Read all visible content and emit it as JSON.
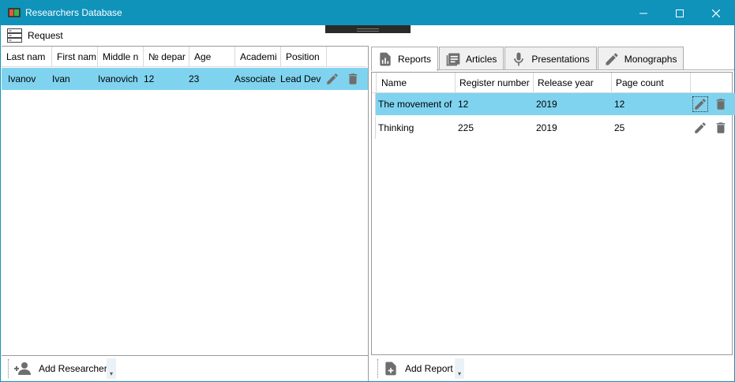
{
  "window": {
    "title": "Researchers Database",
    "accent": "#0f93bb",
    "selection_color": "#7fd3ef"
  },
  "menu": {
    "request_label": "Request",
    "request_icon": "server-list-icon"
  },
  "researchers": {
    "columns": [
      "Last nam",
      "First nam",
      "Middle n",
      "№ depar",
      "Age",
      "Academi",
      "Position"
    ],
    "rows": [
      {
        "last_name": "Ivanov",
        "first_name": "Ivan",
        "middle_name": "Ivanovich",
        "department": "12",
        "age": "23",
        "academic": "Associate",
        "position": "Lead Deve"
      }
    ],
    "add_label": "Add Researcher"
  },
  "tabs": [
    {
      "label": "Reports",
      "icon": "report-chart-icon",
      "active": true
    },
    {
      "label": "Articles",
      "icon": "article-icon",
      "active": false
    },
    {
      "label": "Presentations",
      "icon": "microphone-icon",
      "active": false
    },
    {
      "label": "Monographs",
      "icon": "pen-icon",
      "active": false
    }
  ],
  "reports": {
    "columns": [
      "Name",
      "Register number",
      "Release year",
      "Page count"
    ],
    "rows": [
      {
        "name": "The movement of",
        "register_number": "12",
        "release_year": "2019",
        "page_count": "12"
      },
      {
        "name": "Thinking",
        "register_number": "225",
        "release_year": "2019",
        "page_count": "25"
      }
    ],
    "add_label": "Add Report"
  }
}
